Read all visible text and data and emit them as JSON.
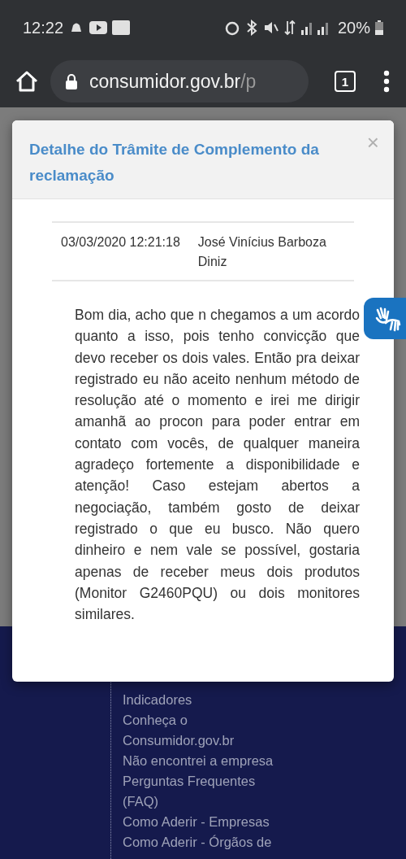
{
  "status_bar": {
    "time": "12:22",
    "battery": "20%"
  },
  "browser": {
    "url_host": "consumidor.gov.br",
    "url_rest": "/p",
    "tab_count": "1"
  },
  "modal": {
    "title": "Detalhe do Trâmite de Complemento da reclamação",
    "close": "×",
    "date": "03/03/2020 12:21:18",
    "author": "José Vinícius Barboza Diniz",
    "message": "Bom dia, acho que n chegamos a um acordo quanto a isso, pois tenho convicção que devo receber os dois vales. Então pra deixar registrado eu não aceito nenhum método de resolução até o momento e irei me dirigir amanhã ao procon para poder entrar em contato com vocês, de qualquer maneira agradeço fortemente a disponibilidade e atenção! Caso estejam abertos a negociação, também gosto de deixar registrado o que eu busco. Não quero dinheiro e nem vale se possível, gostaria apenas de receber meus dois produtos (Monitor G2460PQU) ou dois monitores similares."
  },
  "footer_links": [
    "Indicadores",
    "Conheça o Consumidor.gov.br",
    "Não encontrei a empresa",
    "Perguntas Frequentes (FAQ)",
    "Como Aderir - Empresas",
    "Como Aderir - Órgãos de"
  ]
}
